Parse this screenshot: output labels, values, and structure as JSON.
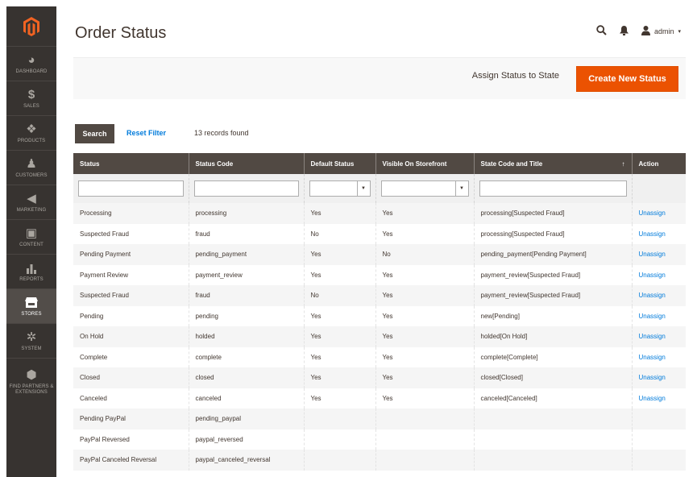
{
  "sidebar": {
    "items": [
      {
        "label": "DASHBOARD",
        "icon": "dashboard-icon"
      },
      {
        "label": "SALES",
        "icon": "dollar-icon"
      },
      {
        "label": "PRODUCTS",
        "icon": "box-icon"
      },
      {
        "label": "CUSTOMERS",
        "icon": "person-icon"
      },
      {
        "label": "MARKETING",
        "icon": "megaphone-icon"
      },
      {
        "label": "CONTENT",
        "icon": "layout-icon"
      },
      {
        "label": "REPORTS",
        "icon": "bar-chart-icon"
      },
      {
        "label": "STORES",
        "icon": "store-icon"
      },
      {
        "label": "SYSTEM",
        "icon": "gear-icon"
      },
      {
        "label": "FIND PARTNERS & EXTENSIONS",
        "icon": "puzzle-icon"
      }
    ],
    "active": "STORES"
  },
  "header": {
    "title": "Order Status",
    "user": "admin"
  },
  "actions": {
    "assign_label": "Assign Status to State",
    "create_label": "Create New Status",
    "accent": "#eb5202"
  },
  "grid": {
    "search_label": "Search",
    "reset_label": "Reset Filter",
    "records": "13 records found",
    "columns": [
      "Status",
      "Status Code",
      "Default Status",
      "Visible On Storefront",
      "State Code and Title",
      "Action"
    ],
    "rows": [
      {
        "status": "Processing",
        "code": "processing",
        "default": "Yes",
        "visible": "Yes",
        "state": "processing[Suspected Fraud]",
        "action": "Unassign"
      },
      {
        "status": "Suspected Fraud",
        "code": "fraud",
        "default": "No",
        "visible": "Yes",
        "state": "processing[Suspected Fraud]",
        "action": "Unassign"
      },
      {
        "status": "Pending Payment",
        "code": "pending_payment",
        "default": "Yes",
        "visible": "No",
        "state": "pending_payment[Pending Payment]",
        "action": "Unassign"
      },
      {
        "status": "Payment Review",
        "code": "payment_review",
        "default": "Yes",
        "visible": "Yes",
        "state": "payment_review[Suspected Fraud]",
        "action": "Unassign"
      },
      {
        "status": "Suspected Fraud",
        "code": "fraud",
        "default": "No",
        "visible": "Yes",
        "state": "payment_review[Suspected Fraud]",
        "action": "Unassign"
      },
      {
        "status": "Pending",
        "code": "pending",
        "default": "Yes",
        "visible": "Yes",
        "state": "new[Pending]",
        "action": "Unassign"
      },
      {
        "status": "On Hold",
        "code": "holded",
        "default": "Yes",
        "visible": "Yes",
        "state": "holded[On Hold]",
        "action": "Unassign"
      },
      {
        "status": "Complete",
        "code": "complete",
        "default": "Yes",
        "visible": "Yes",
        "state": "complete[Complete]",
        "action": "Unassign"
      },
      {
        "status": "Closed",
        "code": "closed",
        "default": "Yes",
        "visible": "Yes",
        "state": "closed[Closed]",
        "action": "Unassign"
      },
      {
        "status": "Canceled",
        "code": "canceled",
        "default": "Yes",
        "visible": "Yes",
        "state": "canceled[Canceled]",
        "action": "Unassign"
      },
      {
        "status": "Pending PayPal",
        "code": "pending_paypal",
        "default": "",
        "visible": "",
        "state": "",
        "action": ""
      },
      {
        "status": "PayPal Reversed",
        "code": "paypal_reversed",
        "default": "",
        "visible": "",
        "state": "",
        "action": ""
      },
      {
        "status": "PayPal Canceled Reversal",
        "code": "paypal_canceled_reversal",
        "default": "",
        "visible": "",
        "state": "",
        "action": ""
      }
    ]
  }
}
